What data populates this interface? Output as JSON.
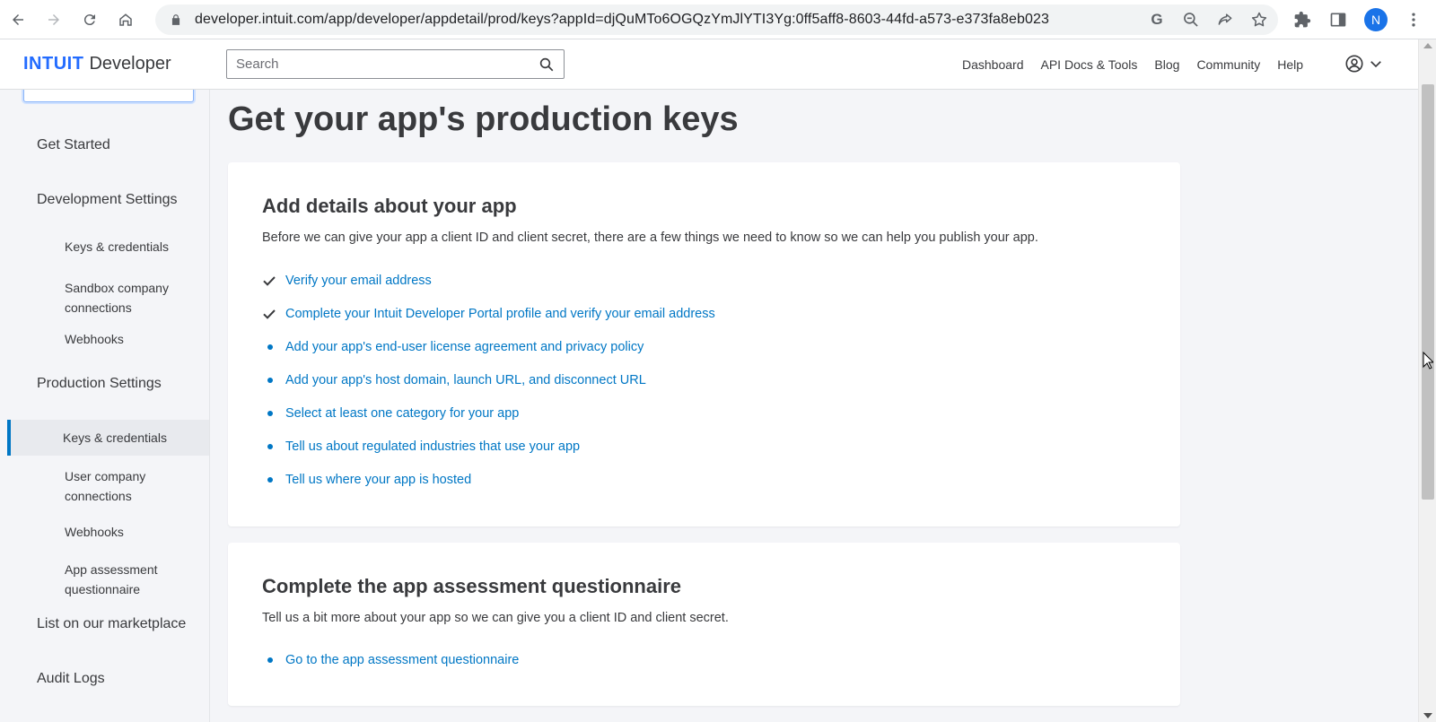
{
  "browser": {
    "url": "developer.intuit.com/app/developer/appdetail/prod/keys?appId=djQuMTo6OGQzYmJlYTI3Yg:0ff5aff8-8603-44fd-a573-e373fa8eb023",
    "profile_initial": "N"
  },
  "header": {
    "logo_brand": "INTUIT",
    "logo_product": "Developer",
    "search_placeholder": "Search",
    "nav": [
      "Dashboard",
      "API Docs & Tools",
      "Blog",
      "Community",
      "Help"
    ]
  },
  "sidebar": {
    "items": [
      {
        "label": "Get Started"
      },
      {
        "label": "Development Settings"
      },
      {
        "label": "Keys & credentials"
      },
      {
        "label": "Sandbox company connections"
      },
      {
        "label": "Webhooks"
      },
      {
        "label": "Production Settings"
      },
      {
        "label": "Keys & credentials"
      },
      {
        "label": "User company connections"
      },
      {
        "label": "Webhooks"
      },
      {
        "label": "App assessment questionnaire"
      },
      {
        "label": "List on our marketplace"
      },
      {
        "label": "Audit Logs"
      }
    ]
  },
  "main": {
    "title": "Get your app's production keys",
    "card1": {
      "title": "Add details about your app",
      "desc": "Before we can give your app a client ID and client secret, there are a few things we need to know so we can help you publish your app.",
      "tasks": [
        {
          "label": "Verify your email address",
          "done": true
        },
        {
          "label": "Complete your Intuit Developer Portal profile and verify your email address",
          "done": true
        },
        {
          "label": "Add your app's end-user license agreement and privacy policy",
          "done": false
        },
        {
          "label": "Add your app's host domain, launch URL, and disconnect URL",
          "done": false
        },
        {
          "label": "Select at least one category for your app",
          "done": false
        },
        {
          "label": "Tell us about regulated industries that use your app",
          "done": false
        },
        {
          "label": "Tell us where your app is hosted",
          "done": false
        }
      ]
    },
    "card2": {
      "title": "Complete the app assessment questionnaire",
      "desc": "Tell us a bit more about your app so we can give you a client ID and client secret.",
      "tasks": [
        {
          "label": "Go to the app assessment questionnaire",
          "done": false
        }
      ]
    }
  },
  "colors": {
    "brand": "#236cff",
    "link": "#0077c5",
    "text": "#393a3d",
    "background": "#f4f5f8"
  }
}
